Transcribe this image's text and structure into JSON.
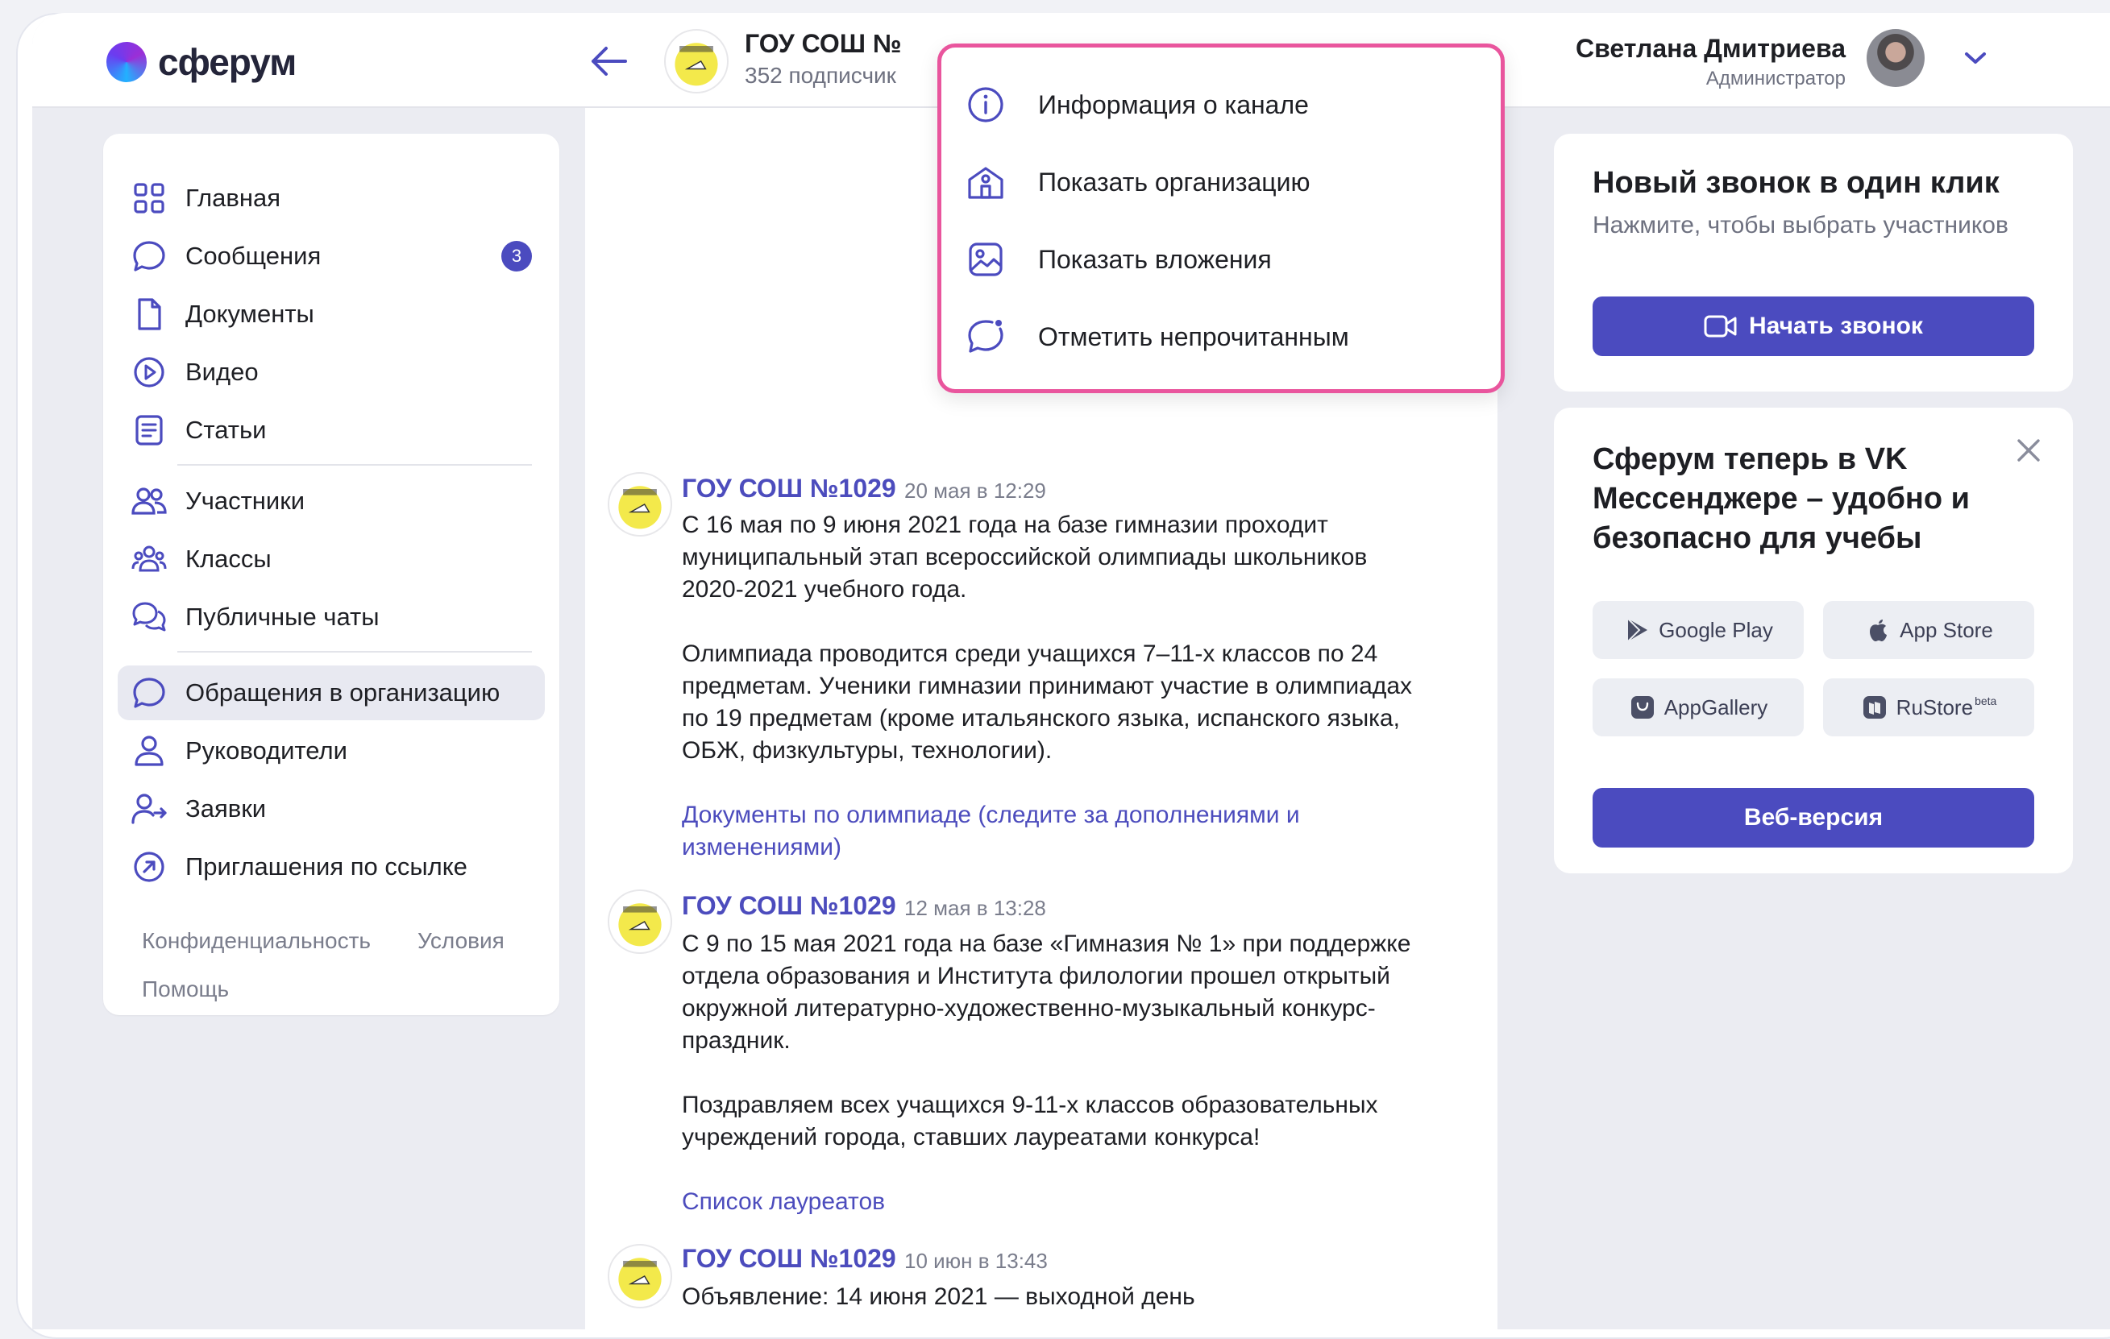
{
  "brand": {
    "name": "сферум"
  },
  "header": {
    "channel_title": "ГОУ СОШ №",
    "channel_subscribers": "352 подписчик",
    "user_name": "Светлана Дмитриева",
    "user_role": "Администратор"
  },
  "sidebar": {
    "items": [
      {
        "label": "Главная",
        "icon": "grid-icon"
      },
      {
        "label": "Сообщения",
        "icon": "message-icon",
        "badge": "3"
      },
      {
        "label": "Документы",
        "icon": "document-icon"
      },
      {
        "label": "Видео",
        "icon": "play-icon"
      },
      {
        "label": "Статьи",
        "icon": "article-icon"
      },
      {
        "label": "Участники",
        "icon": "users-icon"
      },
      {
        "label": "Классы",
        "icon": "classes-icon"
      },
      {
        "label": "Публичные чаты",
        "icon": "public-chats-icon"
      },
      {
        "label": "Обращения в организацию",
        "icon": "message-icon",
        "active": true
      },
      {
        "label": "Руководители",
        "icon": "person-icon"
      },
      {
        "label": "Заявки",
        "icon": "person-arrow-icon"
      },
      {
        "label": "Приглашения по ссылке",
        "icon": "arrow-up-right-circle-icon"
      }
    ],
    "footer": {
      "privacy": "Конфиденциальность",
      "terms": "Условия",
      "help": "Помощь"
    }
  },
  "dropdown": {
    "items": [
      {
        "label": "Информация о канале",
        "icon": "info-icon"
      },
      {
        "label": "Показать организацию",
        "icon": "organization-icon"
      },
      {
        "label": "Показать вложения",
        "icon": "image-icon"
      },
      {
        "label": "Отметить непрочитанным",
        "icon": "unread-icon"
      }
    ]
  },
  "posts": [
    {
      "author": "ГОУ СОШ №1029",
      "time": "20 мая в 12:29",
      "paragraphs": [
        "С 16 мая по 9 июня 2021 года на базе гимназии проходит муниципальный этап всероссийской олимпиады школьников 2020-2021 учебного года.",
        "Олимпиада проводится среди учащихся 7–11-х классов по 24 предметам. Ученики гимназии принимают участие в олимпиадах по 19 предметам (кроме итальянского языка, испанского языка, ОБЖ, физкультуры, технологии)."
      ],
      "link": "Документы по олимпиаде (следите за дополнениями и изменениями)"
    },
    {
      "author": "ГОУ СОШ №1029",
      "time": "12 мая в 13:28",
      "paragraphs": [
        "С 9 по 15 мая 2021 года на базе «Гимназия № 1» при поддержке отдела образования и Института филологии прошел открытый окружной литературно-художественно-музыкальный конкурс-праздник.",
        "Поздравляем всех учащихся 9-11-х классов образовательных учреждений города, ставших лауреатами конкурса!"
      ],
      "link": "Список лауреатов"
    },
    {
      "author": "ГОУ СОШ №1029",
      "time": "10 июн в 13:43",
      "paragraphs": [
        "Объявление: 14 июня 2021 — выходной день"
      ]
    }
  ],
  "call_card": {
    "title": "Новый звонок в один клик",
    "subtitle": "Нажмите, чтобы выбрать участников",
    "button": "Начать звонок"
  },
  "promo_card": {
    "title": "Сферум теперь в VK Мессенджере – удобно и безопасно для учебы",
    "stores": [
      {
        "label": "Google Play",
        "icon": "google-play-icon"
      },
      {
        "label": "App Store",
        "icon": "apple-icon"
      },
      {
        "label": "AppGallery",
        "icon": "huawei-icon"
      },
      {
        "label": "RuStore",
        "icon": "rustore-icon",
        "suffix": "beta"
      }
    ],
    "web_button": "Веб-версия"
  },
  "colors": {
    "accent": "#4b4bbf",
    "highlight": "#e9559d",
    "link": "#4c4cbd"
  }
}
